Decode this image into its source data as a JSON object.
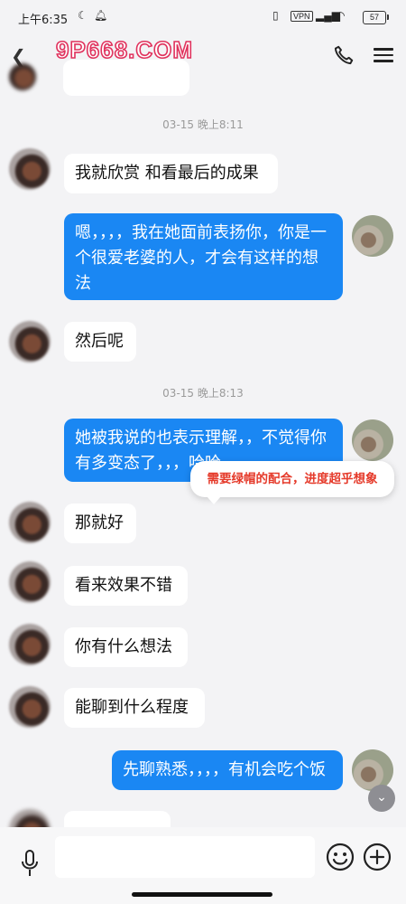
{
  "status_bar": {
    "time": "上午6:35",
    "vpn": "VPN",
    "battery": "57"
  },
  "header": {
    "title": "9P668.COM"
  },
  "timestamps": [
    "03-15 晚上8:11",
    "03-15 晚上8:13"
  ],
  "messages": [
    {
      "side": "in",
      "text": "我就欣赏 和看最后的成果"
    },
    {
      "side": "out",
      "text": "嗯，，，，我在她面前表扬你，你是一个很爱老婆的人，才会有这样的想法"
    },
    {
      "side": "in",
      "text": "然后呢"
    },
    {
      "side": "out",
      "text": "她被我说的也表示理解，，不觉得你有多变态了，，，哈哈"
    },
    {
      "side": "in",
      "text": "那就好"
    },
    {
      "side": "in",
      "text": "看来效果不错"
    },
    {
      "side": "in",
      "text": "你有什么想法"
    },
    {
      "side": "in",
      "text": "能聊到什么程度"
    },
    {
      "side": "out",
      "text": "先聊熟悉，，，，有机会吃个饭"
    }
  ],
  "annotation": "需要绿帽的配合，进度超乎想象",
  "colors": {
    "outgoing_bubble": "#1a87f3",
    "incoming_bubble": "#ffffff",
    "background": "#f3f3f5",
    "annotation_text": "#e53a2a",
    "title_stroke": "#e0325d"
  },
  "icons": [
    "back-icon",
    "phone-icon",
    "menu-icon",
    "mic-icon",
    "emoji-icon",
    "plus-icon",
    "chevron-down-icon"
  ]
}
